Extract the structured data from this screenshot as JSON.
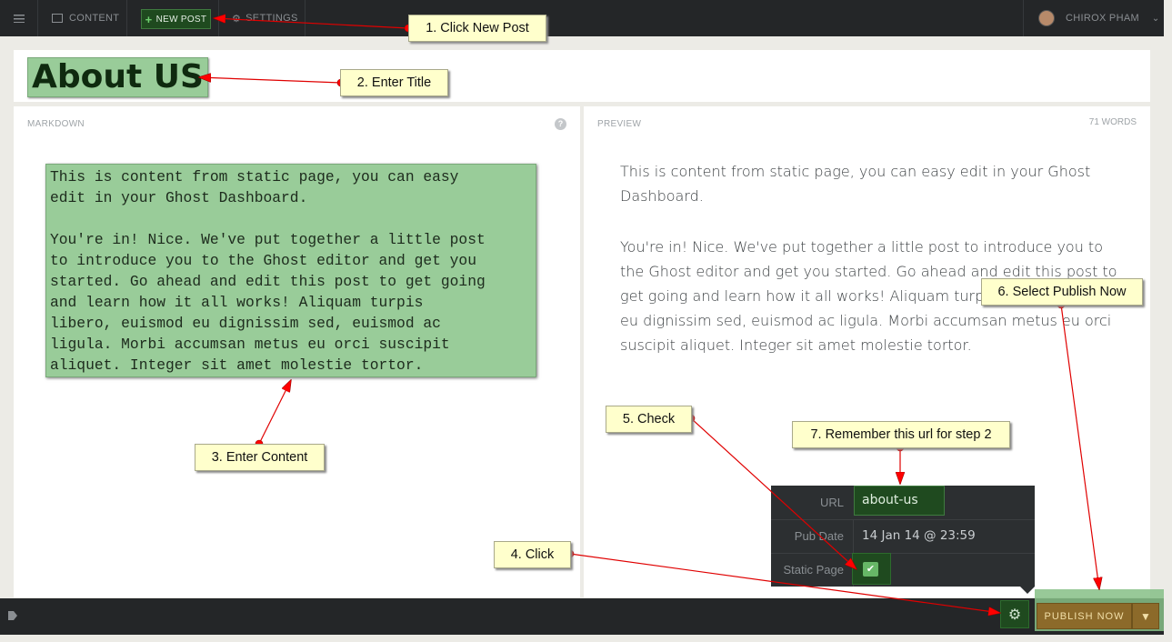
{
  "topbar": {
    "content_label": "CONTENT",
    "new_post_label": "NEW POST",
    "settings_label": "SETTINGS",
    "user_name": "CHIROX PHAM"
  },
  "editor": {
    "title": "About US",
    "markdown_label": "MARKDOWN",
    "preview_label": "PREVIEW",
    "word_count": "71 WORDS",
    "help_glyph": "?",
    "markdown_text": "This is content from static page, you can easy\nedit in your Ghost Dashboard.\n\nYou're in! Nice. We've put together a little post\nto introduce you to the Ghost editor and get you\nstarted. Go ahead and edit this post to get going\nand learn how it all works! Aliquam turpis\nlibero, euismod eu dignissim sed, euismod ac\nligula. Morbi accumsan metus eu orci suscipit\naliquet. Integer sit amet molestie tortor.",
    "preview_paragraphs": [
      "This is content from static page, you can easy edit in your Ghost Dashboard.",
      "You're in! Nice. We've put together a little post to introduce you to the Ghost editor and get you started. Go ahead and edit this post to get going and learn how it all works! Aliquam turpis libero, euismod eu dignissim sed, euismod ac ligula. Morbi accumsan metus eu orci suscipit aliquet. Integer sit amet molestie tortor."
    ]
  },
  "post_settings": {
    "url_label": "URL",
    "url_value": "about-us",
    "pubdate_label": "Pub Date",
    "pubdate_value": "14 Jan 14 @ 23:59",
    "static_label": "Static Page",
    "static_checked": true
  },
  "footer": {
    "publish_label": "PUBLISH NOW"
  },
  "annotations": {
    "step1": "1. Click New Post",
    "step2": "2. Enter Title",
    "step3": "3. Enter Content",
    "step4": "4. Click",
    "step5": "5. Check",
    "step6": "6. Select Publish Now",
    "step7": "7. Remember this url for step 2"
  },
  "colors": {
    "arrow": "#ff0000",
    "highlight": "#99cc99",
    "note_bg": "#ffffcc"
  }
}
